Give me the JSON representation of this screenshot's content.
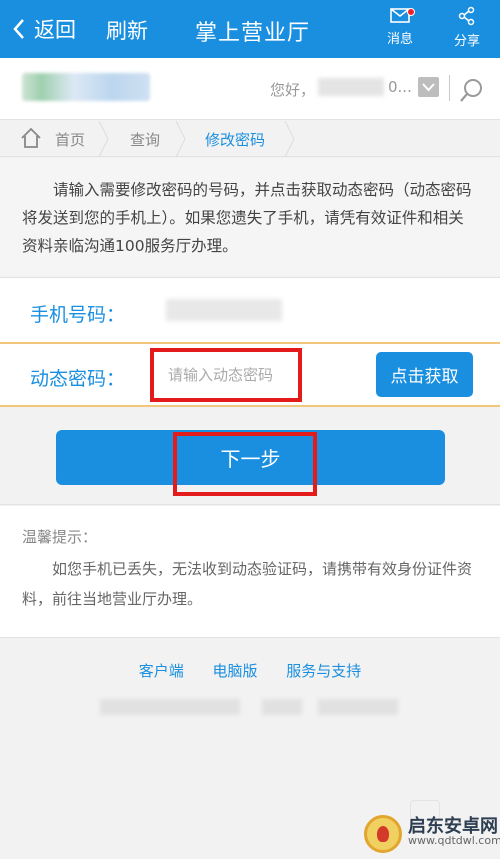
{
  "topbar": {
    "back_label": "返回",
    "refresh_label": "刷新",
    "title": "掌上营业厅",
    "messages_label": "消息",
    "share_label": "分享"
  },
  "userbar": {
    "greeting": "您好，",
    "ellipsis": "0..."
  },
  "breadcrumb": {
    "home": "首页",
    "query": "查询",
    "current": "修改密码"
  },
  "info": {
    "text": "请输入需要修改密码的号码，并点击获取动态密码（动态密码将发送到您的手机上）。如果您遗失了手机，请凭有效证件和相关资料亲临沟通100服务厅办理。"
  },
  "form": {
    "phone_label": "手机号码：",
    "code_label": "动态密码：",
    "code_placeholder": "请输入动态密码",
    "get_code_button": "点击获取"
  },
  "next_button": "下一步",
  "tips": {
    "title": "温馨提示：",
    "text": "如您手机已丢失，无法收到动态验证码，请携带有效身份证件资料，前往当地营业厅办理。"
  },
  "footer": {
    "links": [
      "客户端",
      "电脑版",
      "服务与支持"
    ]
  },
  "watermark": {
    "title": "启东安卓网",
    "url": "www.qdtdwl.com"
  },
  "colors": {
    "accent": "#1a8fe0",
    "highlight_red": "#e31b1b",
    "focus_border": "#f2c77d"
  }
}
